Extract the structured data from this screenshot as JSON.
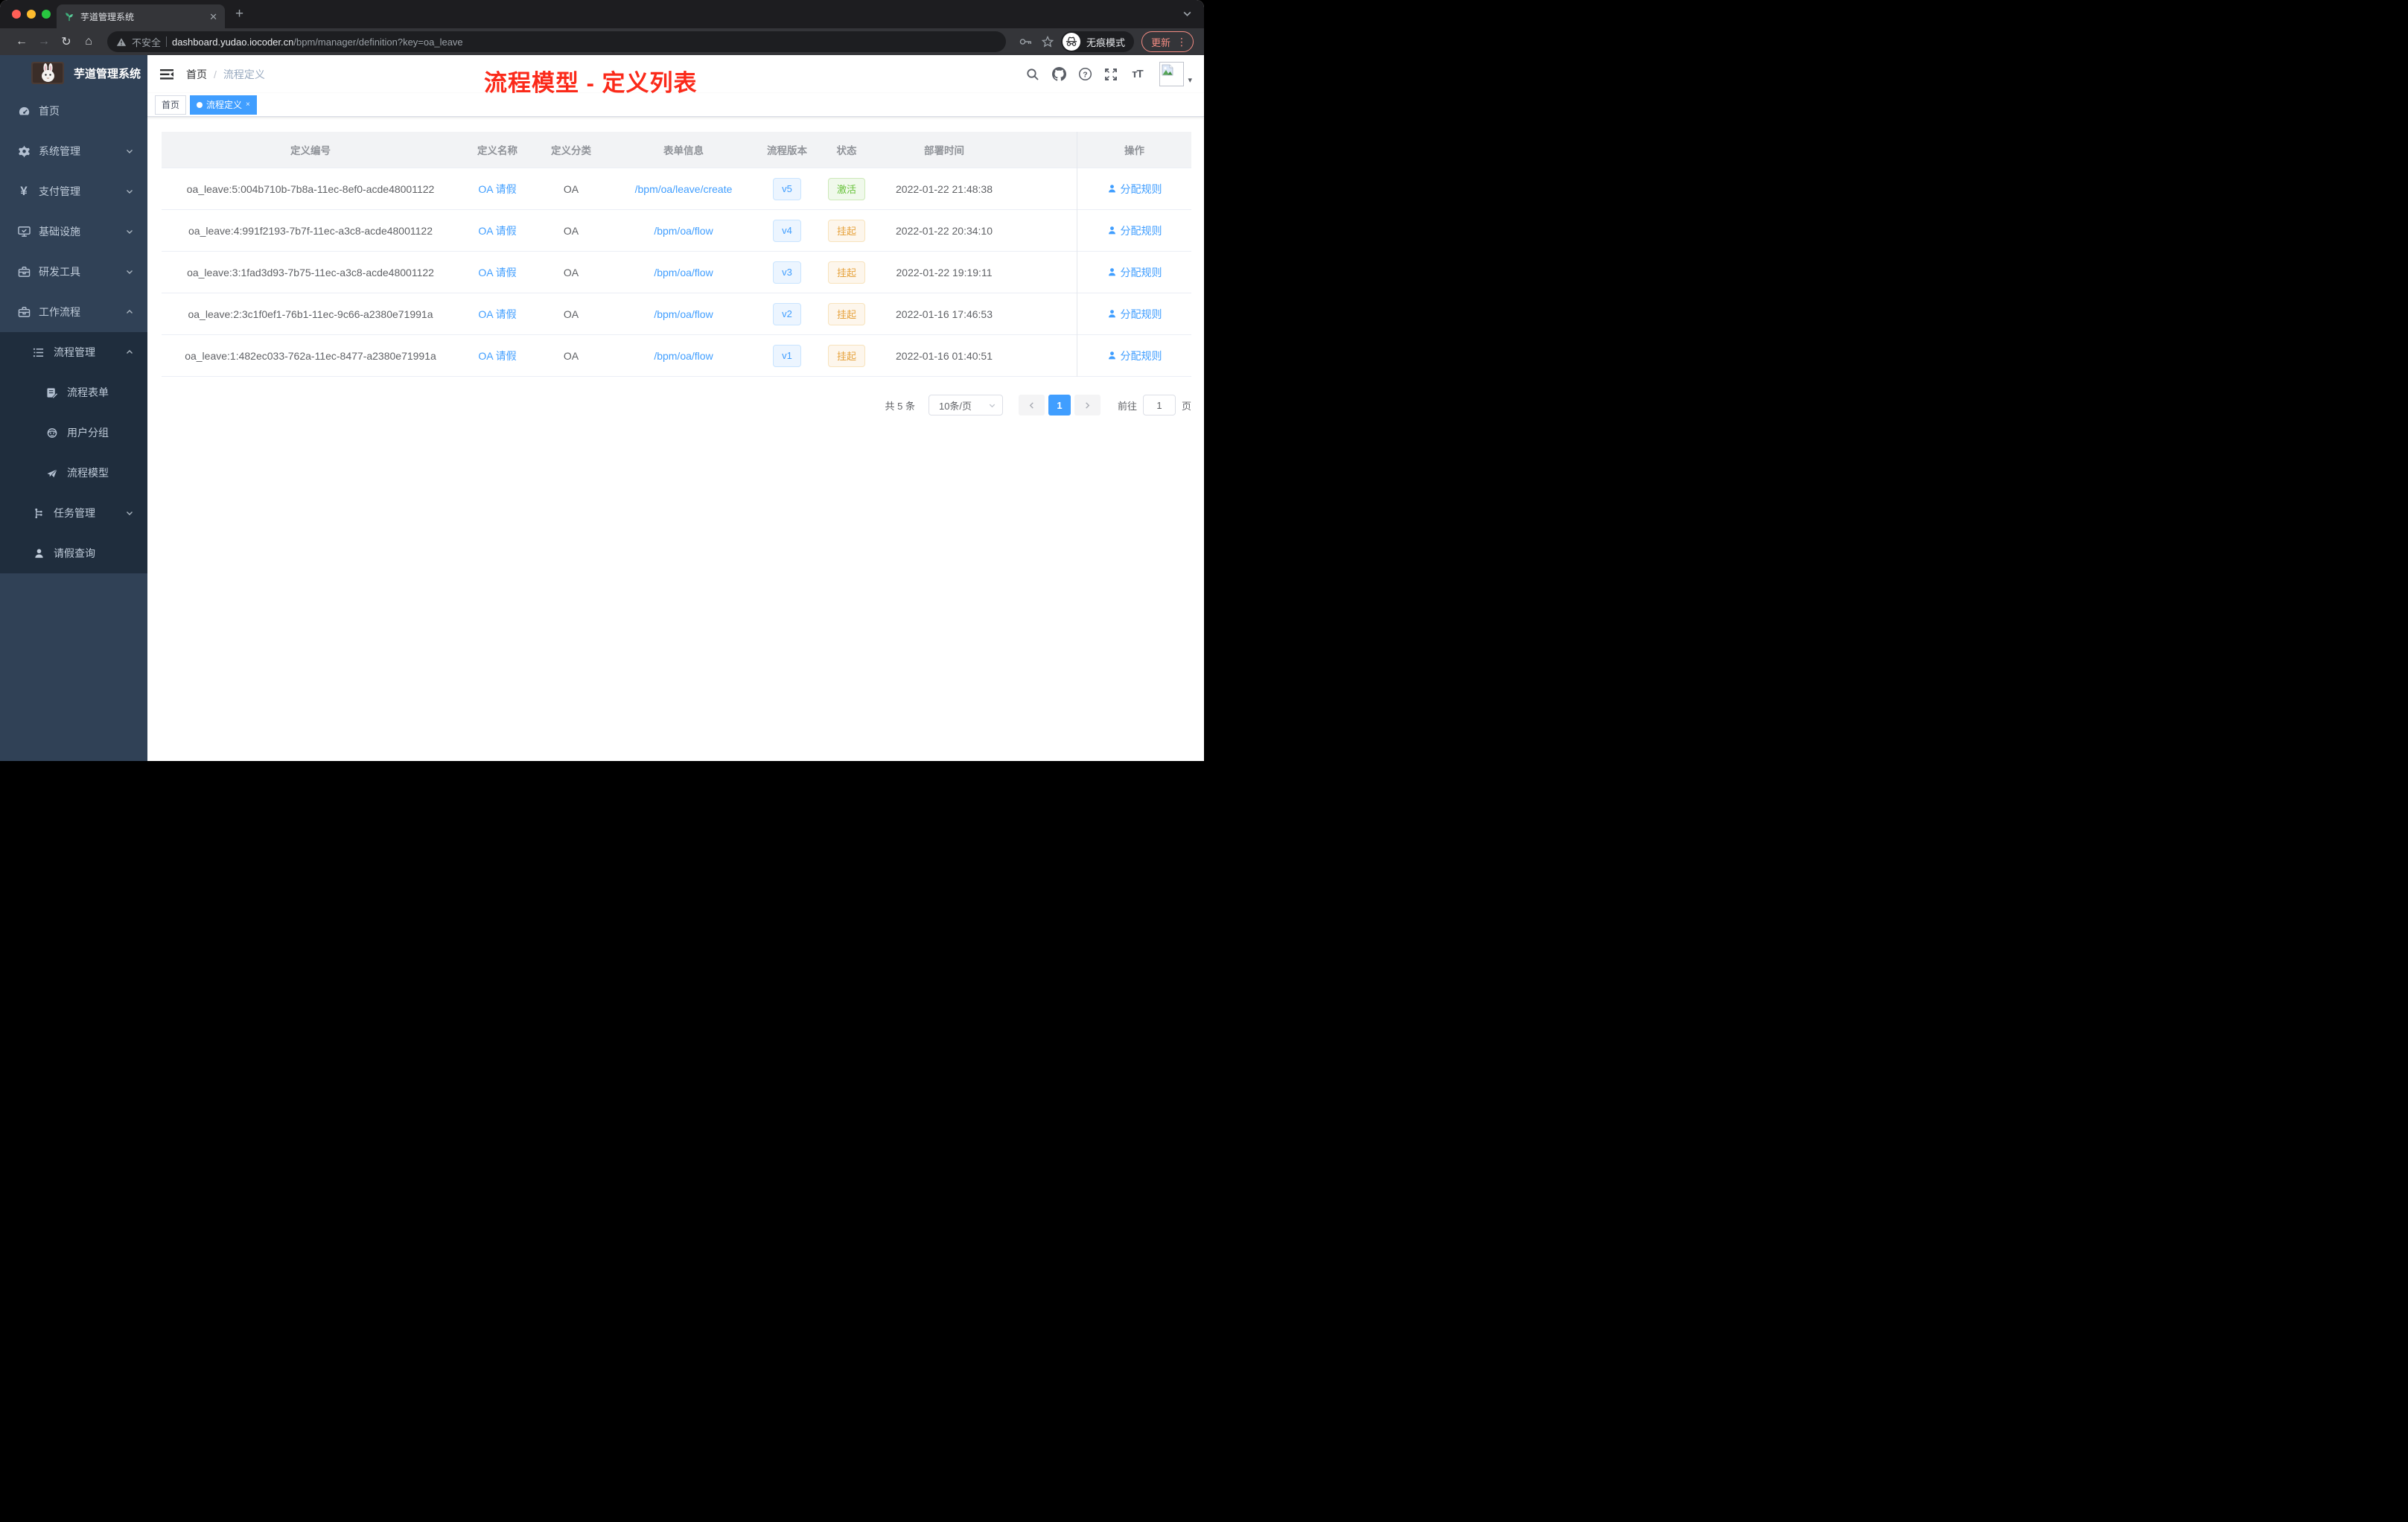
{
  "browser": {
    "tab_title": "芋道管理系统",
    "security_label": "不安全",
    "url_host": "dashboard.yudao.iocoder.cn",
    "url_path": "/bpm/manager/definition?key=oa_leave",
    "incognito_label": "无痕模式",
    "update_label": "更新"
  },
  "annotation": {
    "text": "流程模型 - 定义列表",
    "color": "#fb2a1a"
  },
  "sidebar": {
    "logo_title": "芋道管理系统",
    "menu": [
      {
        "label": "首页",
        "icon": "dashboard-icon",
        "level": 1
      },
      {
        "label": "系统管理",
        "icon": "gear-icon",
        "level": 1,
        "arrow": "down"
      },
      {
        "label": "支付管理",
        "icon": "yuan-icon",
        "level": 1,
        "arrow": "down"
      },
      {
        "label": "基础设施",
        "icon": "monitor-icon",
        "level": 1,
        "arrow": "down"
      },
      {
        "label": "研发工具",
        "icon": "toolbox-icon",
        "level": 1,
        "arrow": "down"
      },
      {
        "label": "工作流程",
        "icon": "briefcase-icon",
        "level": 1,
        "arrow": "up"
      },
      {
        "label": "流程管理",
        "icon": "list-tree-icon",
        "level": 2,
        "arrow": "up"
      },
      {
        "label": "流程表单",
        "icon": "form-edit-icon",
        "level": 3
      },
      {
        "label": "用户分组",
        "icon": "robot-icon",
        "level": 3
      },
      {
        "label": "流程模型",
        "icon": "paper-plane-icon",
        "level": 3
      },
      {
        "label": "任务管理",
        "icon": "org-tree-icon",
        "level": 2,
        "arrow": "down"
      },
      {
        "label": "请假查询",
        "icon": "user-icon",
        "level": 2
      }
    ]
  },
  "navbar": {
    "breadcrumb": {
      "home": "首页",
      "sep": "/",
      "current": "流程定义"
    }
  },
  "tags": [
    {
      "label": "首页",
      "active": false
    },
    {
      "label": "流程定义",
      "active": true
    }
  ],
  "table": {
    "columns": [
      "定义编号",
      "定义名称",
      "定义分类",
      "表单信息",
      "流程版本",
      "状态",
      "部署时间",
      "操作"
    ],
    "rows": [
      {
        "id": "oa_leave:5:004b710b-7b8a-11ec-8ef0-acde48001122",
        "name": "OA 请假",
        "category": "OA",
        "form": "/bpm/oa/leave/create",
        "version": "v5",
        "status": {
          "label": "激活",
          "type": "success"
        },
        "deployed_at": "2022-01-22 21:48:38",
        "action": "分配规则"
      },
      {
        "id": "oa_leave:4:991f2193-7b7f-11ec-a3c8-acde48001122",
        "name": "OA 请假",
        "category": "OA",
        "form": "/bpm/oa/flow",
        "version": "v4",
        "status": {
          "label": "挂起",
          "type": "warning"
        },
        "deployed_at": "2022-01-22 20:34:10",
        "action": "分配规则"
      },
      {
        "id": "oa_leave:3:1fad3d93-7b75-11ec-a3c8-acde48001122",
        "name": "OA 请假",
        "category": "OA",
        "form": "/bpm/oa/flow",
        "version": "v3",
        "status": {
          "label": "挂起",
          "type": "warning"
        },
        "deployed_at": "2022-01-22 19:19:11",
        "action": "分配规则"
      },
      {
        "id": "oa_leave:2:3c1f0ef1-76b1-11ec-9c66-a2380e71991a",
        "name": "OA 请假",
        "category": "OA",
        "form": "/bpm/oa/flow",
        "version": "v2",
        "status": {
          "label": "挂起",
          "type": "warning"
        },
        "deployed_at": "2022-01-16 17:46:53",
        "action": "分配规则"
      },
      {
        "id": "oa_leave:1:482ec033-762a-11ec-8477-a2380e71991a",
        "name": "OA 请假",
        "category": "OA",
        "form": "/bpm/oa/flow",
        "version": "v1",
        "status": {
          "label": "挂起",
          "type": "warning"
        },
        "deployed_at": "2022-01-16 01:40:51",
        "action": "分配规则"
      }
    ]
  },
  "pagination": {
    "total": "共 5 条",
    "page_size": "10条/页",
    "current": "1",
    "goto": "前往",
    "unit": "页",
    "goto_value": "1"
  },
  "colors": {
    "accent": "#409eff",
    "success": "#67c23a",
    "warning": "#e6a23c",
    "sidebar_bg": "#304156",
    "submenu_bg": "#1f2d3d",
    "annotation_red": "#fb2a1a",
    "chrome_dark": "#1d1d20",
    "chrome_toolbar": "#343539",
    "update_red": "#f28b82"
  },
  "icons": {
    "favicon-sprout-icon": "green sprout",
    "back-icon": "←",
    "forward-icon": "→",
    "reload-icon": "↻",
    "home-icon": "⌂",
    "warning-icon": "⚠ triangle",
    "key-icon": "key",
    "star-icon": "☆",
    "incognito-icon": "hat and glasses",
    "menu-dots-icon": "⋮",
    "hamburger-collapse-icon": "☰ with left triangle",
    "search-icon": "magnifier",
    "github-icon": "octocat",
    "help-icon": "? in circle",
    "fullscreen-icon": "expand arrows",
    "font-size-icon": "tT",
    "broken-image-icon": "landscape placeholder",
    "chevron-down-icon": "v",
    "chevron-up-icon": "^",
    "user-icon": "person silhouette"
  }
}
